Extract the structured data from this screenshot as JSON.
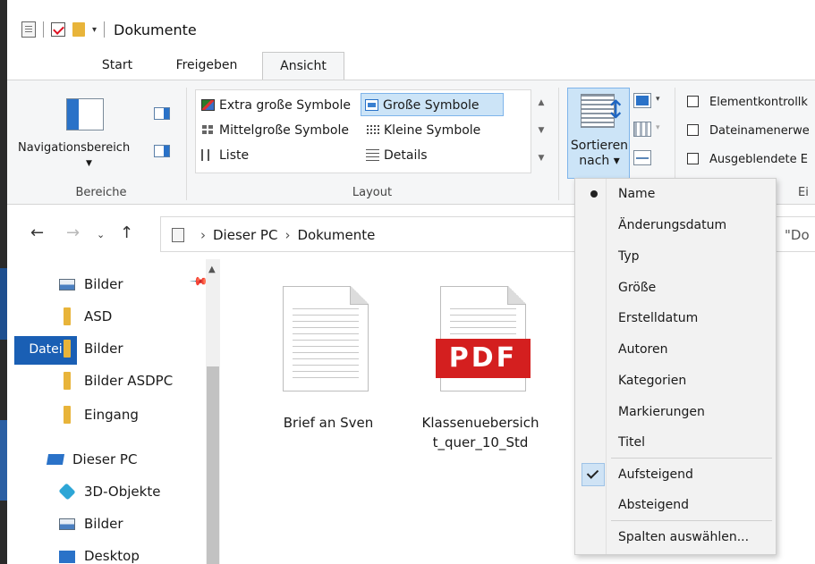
{
  "window": {
    "title": "Dokumente"
  },
  "tabs": {
    "file": "Datei",
    "start": "Start",
    "share": "Freigeben",
    "view": "Ansicht"
  },
  "ribbon": {
    "panes": {
      "nav_pane_label": "Navigationsbereich",
      "group_label": "Bereiche"
    },
    "layout": {
      "group_label": "Layout",
      "items": [
        {
          "label": "Extra große Symbole",
          "icon": "extra-large-icons-icon"
        },
        {
          "label": "Große Symbole",
          "icon": "large-icons-icon",
          "selected": true
        },
        {
          "label": "Mittelgroße Symbole",
          "icon": "medium-icons-icon"
        },
        {
          "label": "Kleine Symbole",
          "icon": "small-icons-icon"
        },
        {
          "label": "Liste",
          "icon": "list-icon"
        },
        {
          "label": "Details",
          "icon": "details-icon"
        }
      ]
    },
    "current_view": {
      "sort_label_line1": "Sortieren",
      "sort_label_line2": "nach ▾",
      "group_label": "Ei"
    },
    "show_hide": {
      "items": [
        "Elementkontrollk",
        "Dateinamenerwe",
        "Ausgeblendete E"
      ]
    }
  },
  "address": {
    "crumbs": [
      "Dieser PC",
      "Dokumente"
    ],
    "search_text": "\"Do"
  },
  "sidebar": {
    "quick_access": [
      {
        "label": "Bilder",
        "icon": "pictures-icon"
      },
      {
        "label": "ASD",
        "icon": "folder-icon"
      },
      {
        "label": "Bilder",
        "icon": "folder-icon"
      },
      {
        "label": "Bilder ASDPC",
        "icon": "folder-icon"
      },
      {
        "label": "Eingang",
        "icon": "folder-icon"
      }
    ],
    "this_pc": {
      "label": "Dieser PC",
      "icon": "computer-icon"
    },
    "pc_items": [
      {
        "label": "3D-Objekte",
        "icon": "3d-objects-icon"
      },
      {
        "label": "Bilder",
        "icon": "pictures-icon"
      },
      {
        "label": "Desktop",
        "icon": "desktop-icon"
      }
    ]
  },
  "files": [
    {
      "name": "Brief an Sven",
      "type": "document"
    },
    {
      "name_line1": "Klassenuebersich",
      "name_line2": "t_quer_10_Std",
      "type": "pdf",
      "badge": "PDF"
    }
  ],
  "sort_menu": {
    "items": [
      {
        "label": "Name",
        "radio": true
      },
      {
        "label": "Änderungsdatum"
      },
      {
        "label": "Typ"
      },
      {
        "label": "Größe"
      },
      {
        "label": "Erstelldatum"
      },
      {
        "label": "Autoren"
      },
      {
        "label": "Kategorien"
      },
      {
        "label": "Markierungen"
      },
      {
        "label": "Titel"
      }
    ],
    "direction": [
      {
        "label": "Aufsteigend",
        "checked": true
      },
      {
        "label": "Absteigend"
      }
    ],
    "columns": "Spalten auswählen..."
  },
  "colors": {
    "file_tab": "#1a5fb4",
    "selection": "#cce4f7",
    "selection_border": "#7eb4ea",
    "folder": "#e8b43a",
    "pdf_red": "#d41f1f"
  }
}
